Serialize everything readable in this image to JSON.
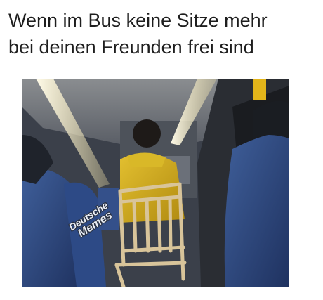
{
  "meme": {
    "caption_line1": "Wenn im Bus keine Sitze mehr",
    "caption_line2": "bei deinen Freunden frei sind",
    "watermark_line1": "Deutsche",
    "watermark_line2": "Memes"
  }
}
